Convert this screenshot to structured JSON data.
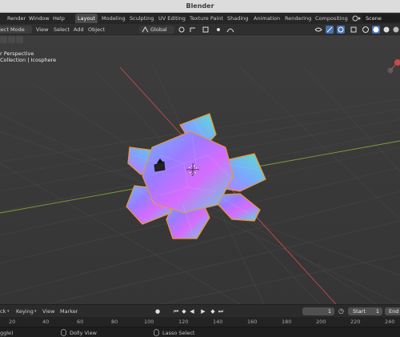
{
  "title": "Blender",
  "menubar": {
    "items": [
      "Render",
      "Window",
      "Help"
    ],
    "workspaces": [
      "Layout",
      "Modeling",
      "Sculpting",
      "UV Editing",
      "Texture Paint",
      "Shading",
      "Animation",
      "Rendering",
      "Compositing"
    ],
    "active_workspace": "Layout",
    "scene": "Scene"
  },
  "toolbar": {
    "mode": "ject Mode",
    "menus": [
      "View",
      "Select",
      "Add",
      "Object"
    ],
    "orientation": "Global"
  },
  "viewport": {
    "perspective": "r Perspective",
    "collection": "Collection | Icosphere"
  },
  "timeline": {
    "menus": [
      "ck",
      "Keying",
      "View",
      "Marker"
    ],
    "current_frame": "1",
    "start_label": "Start",
    "start_value": "1",
    "end_label": "End"
  },
  "ruler": {
    "ticks": [
      "20",
      "40",
      "60",
      "80",
      "100",
      "120",
      "140",
      "160",
      "180",
      "200",
      "220",
      "240"
    ]
  },
  "statusbar": {
    "left": "ggle)",
    "middle": "Dolly View",
    "right": "Lasso Select"
  },
  "colors": {
    "x_axis": "#c84a4a",
    "y_axis": "#7fa03a",
    "selection_outline": "#f0962e",
    "accent_blue": "#4772b3"
  }
}
